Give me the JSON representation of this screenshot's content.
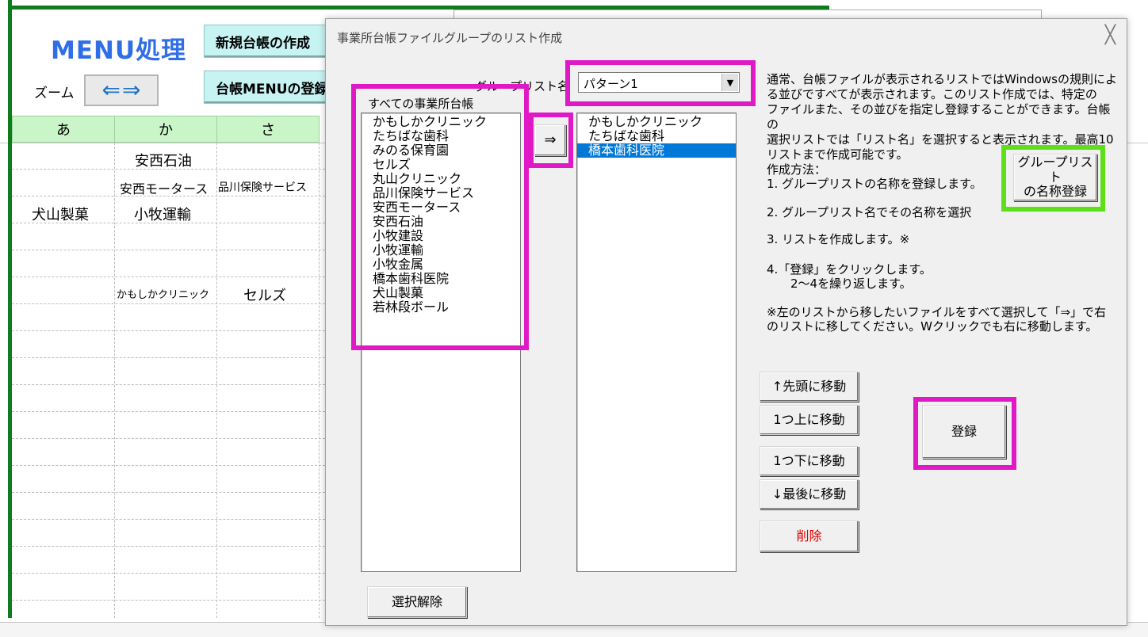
{
  "sheet": {
    "title": "MENU処理",
    "zoom_label": "ズーム",
    "zoom_left": "⇐",
    "zoom_right": "⇒",
    "buttons": [
      "新規台帳の作成",
      "台帳MENUの登録"
    ],
    "columns": [
      "あ",
      "か",
      "さ"
    ],
    "cells": {
      "r1c2": "安西石油",
      "r2c2": "安西モータース",
      "r2c3": "品川保険サービス",
      "r3c1": "犬山製菓",
      "r3c2": "小牧運輸",
      "r6c2": "かもしかクリニック",
      "r6c3": "セルズ"
    }
  },
  "dialog": {
    "title": "事業所台帳ファイルグループのリスト作成",
    "close": "╳",
    "group_list_label": "グループリスト名",
    "group_list_value": "パターン1",
    "all_label": "すべての事業所台帳",
    "all_items": [
      "かもしかクリニック",
      "たちばな歯科",
      "みのる保育園",
      "セルズ",
      "丸山クリニック",
      "品川保険サービス",
      "安西モータース",
      "安西石油",
      "小牧建設",
      "小牧運輸",
      "小牧金属",
      "橋本歯科医院",
      "犬山製菓",
      "若林段ボール"
    ],
    "move_button": "⇒",
    "selected_items": [
      "かもしかクリニック",
      "たちばな歯科",
      "橋本歯科医院"
    ],
    "description": [
      "通常、台帳ファイルが表示されるリストではWindowsの規則によ",
      "る並びですべてが表示されます。このリスト作成では、特定の",
      "ファイルまた、その並びを指定し登録することができます。台帳の",
      "選択リストでは「リスト名」を選択すると表示されます。最高10",
      "リストまで作成可能です。"
    ],
    "method_title": "作成方法：",
    "steps": [
      "1. グループリストの名称を登録します。",
      "2. グループリスト名でその名称を選択",
      "3. リストを作成します。※",
      "4.「登録」をクリックします。",
      "　　2～4を繰り返します。"
    ],
    "note": [
      "※左のリストから移したいファイルをすべて選択して「⇒」で右",
      "のリストに移してください。Wクリックでも右に移動します。"
    ],
    "name_register_button_line1": "グループリスト",
    "name_register_button_line2": "の名称登録",
    "move_top": "↑先頭に移動",
    "move_up": "1つ上に移動",
    "move_down": "1つ下に移動",
    "move_bottom": "↓最後に移動",
    "delete": "削除",
    "register": "登録",
    "deselect": "選択解除"
  },
  "colors": {
    "highlight_pink": "#e019c6",
    "highlight_green": "#5ee019",
    "selection_blue": "#0078d7",
    "delete_text": "#e00000",
    "menu_title": "#2f6ee6",
    "sheet_border": "#0e7c1c"
  }
}
